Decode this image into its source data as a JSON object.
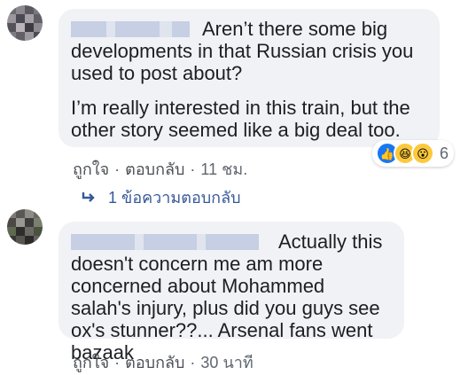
{
  "comments": [
    {
      "text_paragraphs": [
        "Aren’t there some big developments in that Russian crisis you used to post about?",
        "I’m really interested in this train, but the other story seemed like a big deal too."
      ],
      "actions": {
        "like": "ถูกใจ",
        "reply": "ตอบกลับ",
        "time": "11 ชม."
      },
      "reactions": {
        "icons": [
          "like-icon",
          "haha-icon",
          "wow-icon"
        ],
        "count": "6"
      },
      "replies_label": "1 ข้อความตอบกลับ"
    },
    {
      "text": "Actually this doesn't concern me am more concerned about Mohammed salah's injury, plus did you guys see ox's stunner??... Arsenal fans went bazaak",
      "actions": {
        "like": "ถูกใจ",
        "reply": "ตอบกลับ",
        "time": "30 นาที"
      }
    }
  ],
  "colors": {
    "bubble": "#f1f2f6",
    "link": "#365899",
    "meta": "#606770",
    "like_blue": "#1877f2"
  }
}
